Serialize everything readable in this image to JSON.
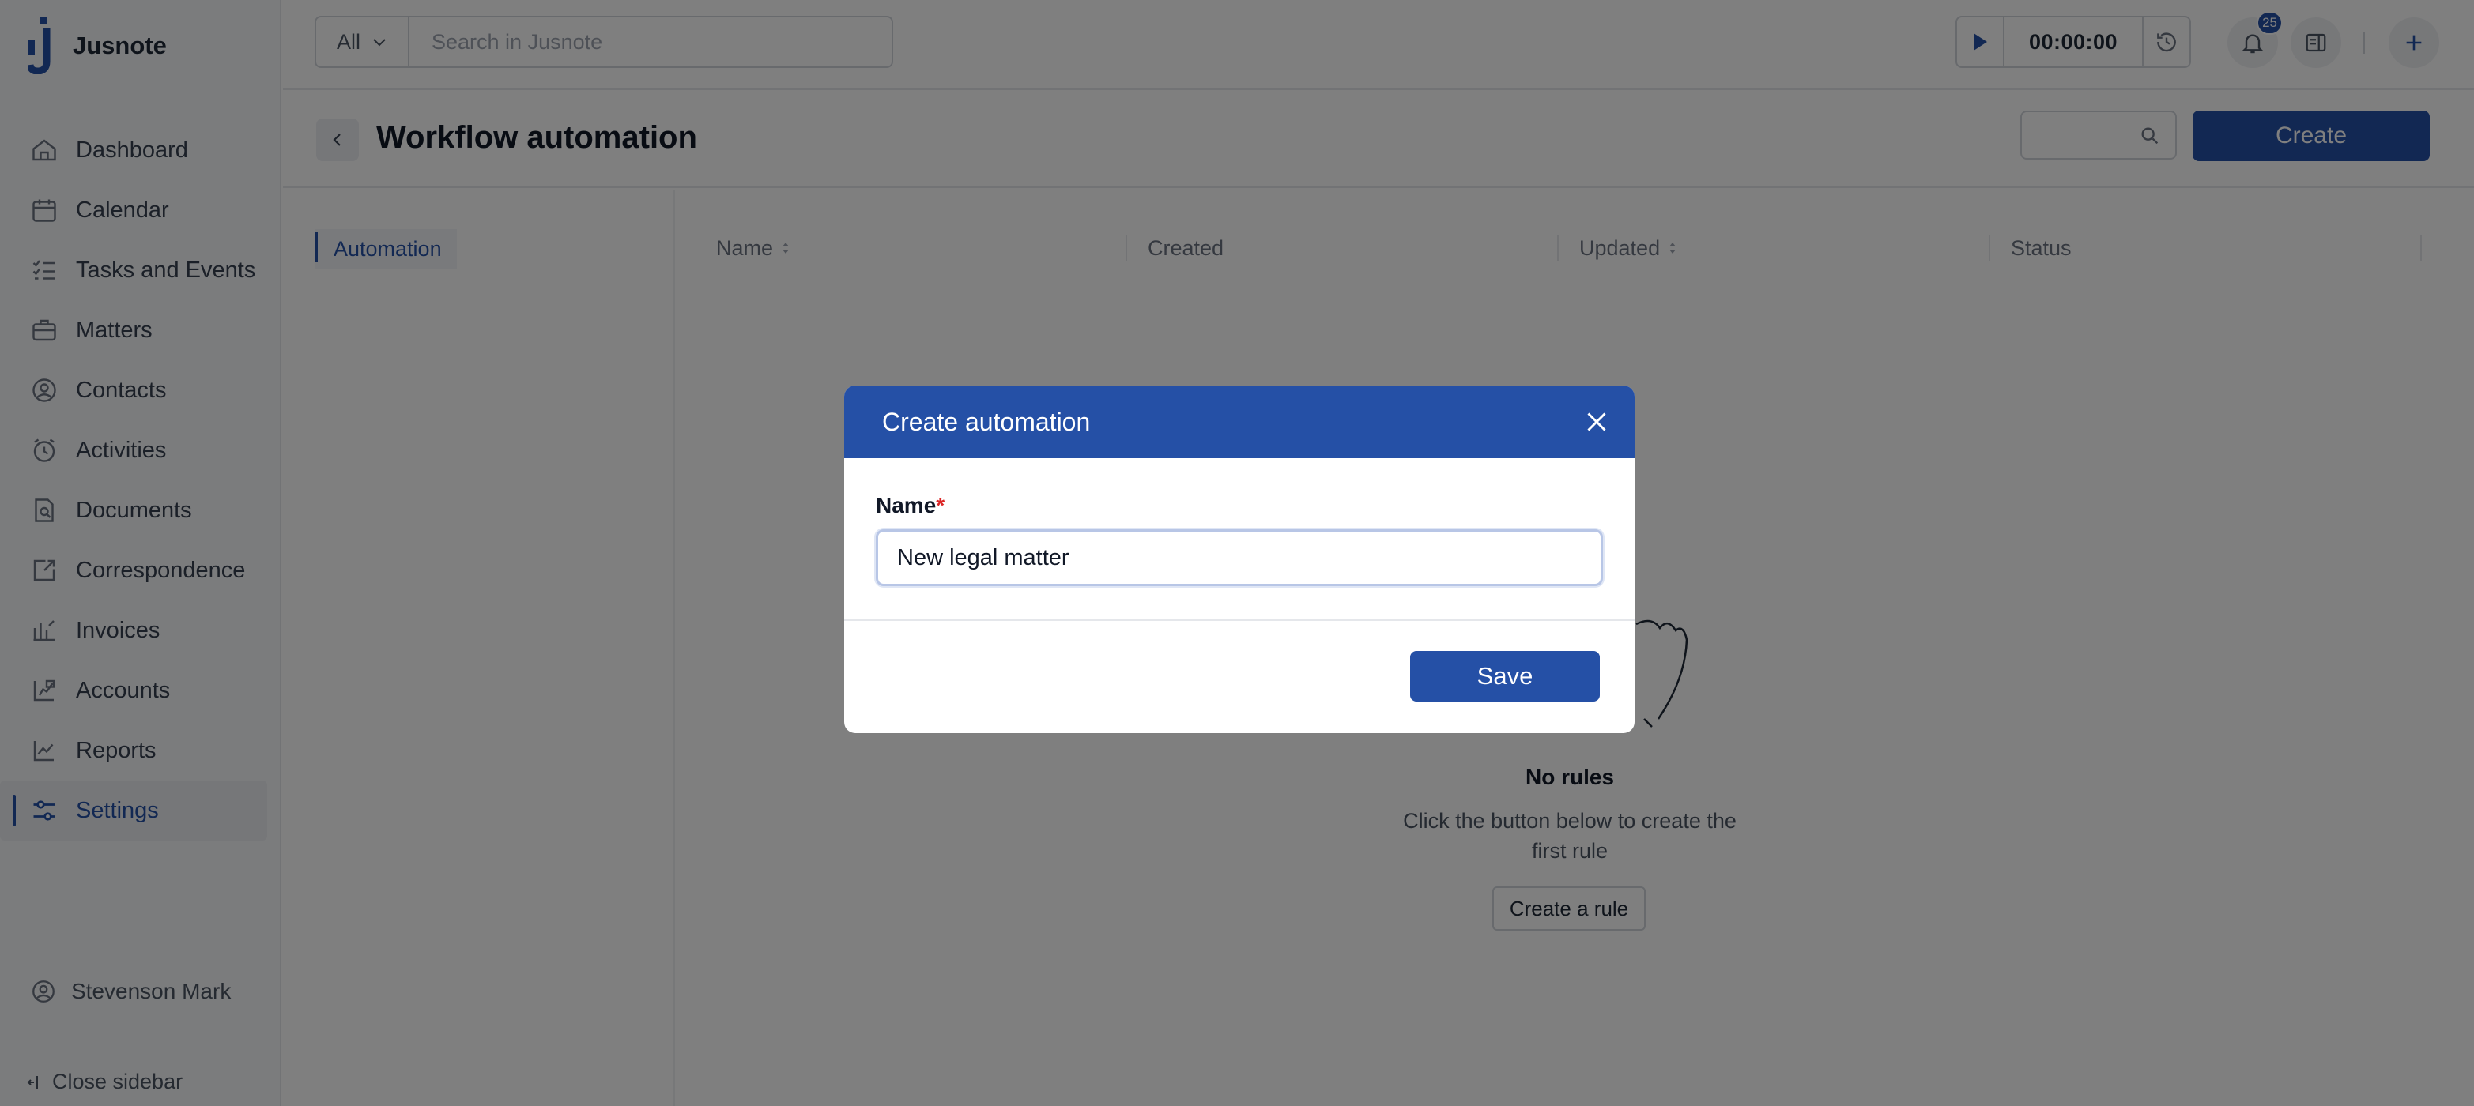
{
  "app": {
    "name": "Jusnote"
  },
  "sidebar": {
    "items": [
      {
        "label": "Dashboard",
        "icon": "home-icon"
      },
      {
        "label": "Calendar",
        "icon": "calendar-icon"
      },
      {
        "label": "Tasks and Events",
        "icon": "tasks-icon"
      },
      {
        "label": "Matters",
        "icon": "briefcase-icon"
      },
      {
        "label": "Contacts",
        "icon": "contacts-icon"
      },
      {
        "label": "Activities",
        "icon": "clock-icon"
      },
      {
        "label": "Documents",
        "icon": "documents-icon"
      },
      {
        "label": "Correspondence",
        "icon": "correspondence-icon"
      },
      {
        "label": "Invoices",
        "icon": "invoice-icon"
      },
      {
        "label": "Accounts",
        "icon": "accounts-icon"
      },
      {
        "label": "Reports",
        "icon": "chart-icon"
      },
      {
        "label": "Settings",
        "icon": "sliders-icon",
        "active": true
      }
    ],
    "user": "Stevenson Mark",
    "close_label": "Close sidebar"
  },
  "topbar": {
    "scope": "All",
    "search_placeholder": "Search in Jusnote",
    "timer": "00:00:00",
    "notifications_count": "25"
  },
  "page": {
    "title": "Workflow automation",
    "create_label": "Create",
    "subnav_label": "Automation"
  },
  "table": {
    "columns": [
      {
        "label": "Name",
        "sortable": true
      },
      {
        "label": "Created",
        "sortable": false
      },
      {
        "label": "Updated",
        "sortable": true
      },
      {
        "label": "Status",
        "sortable": false
      }
    ]
  },
  "empty_state": {
    "title": "No rules",
    "text": "Click the button below to create the first rule",
    "button": "Create a rule"
  },
  "modal": {
    "title": "Create automation",
    "field_label": "Name",
    "required_mark": "*",
    "field_value": "New legal matter",
    "save_label": "Save"
  },
  "colors": {
    "brand": "#2550a6",
    "overlay": "rgba(0,0,0,0.5)",
    "required": "#dc2626"
  }
}
